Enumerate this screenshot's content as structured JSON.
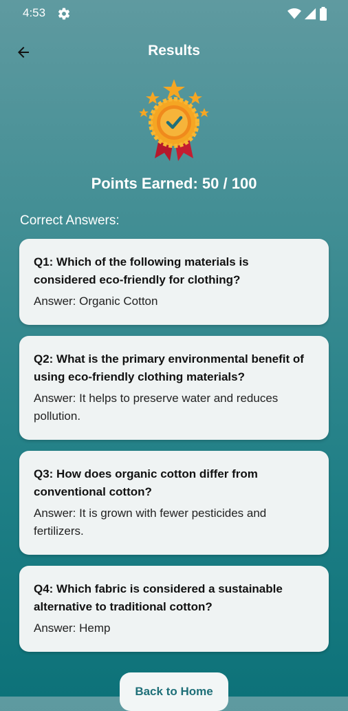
{
  "status_bar": {
    "time": "4:53",
    "icons": [
      "gear-icon",
      "wifi-icon",
      "signal-icon",
      "battery-icon"
    ]
  },
  "app_bar": {
    "title": "Results",
    "back_icon": "arrow-left-icon"
  },
  "medal": {
    "icon": "award-medal-icon",
    "colors": {
      "gold": "#f5a623",
      "ribbon": "#b5182b"
    }
  },
  "points_text": "Points Earned: 50 / 100",
  "section_label": "Correct Answers:",
  "answers": [
    {
      "question": "Q1: Which of the following materials is considered eco-friendly for clothing?",
      "answer": "Answer: Organic Cotton"
    },
    {
      "question": "Q2: What is the primary environmental benefit of using eco-friendly clothing materials?",
      "answer": "Answer: It helps to preserve water and reduces pollution."
    },
    {
      "question": "Q3: How does organic cotton differ from conventional cotton?",
      "answer": "Answer: It is grown with fewer pesticides and fertilizers."
    },
    {
      "question": "Q4: Which fabric is considered a sustainable alternative to traditional cotton?",
      "answer": "Answer: Hemp"
    }
  ],
  "home_button_label": "Back to Home",
  "colors": {
    "background_top": "#5f9aa0",
    "background_bottom": "#0d7279",
    "card": "#eff3f3",
    "button_text": "#1e6f78"
  }
}
